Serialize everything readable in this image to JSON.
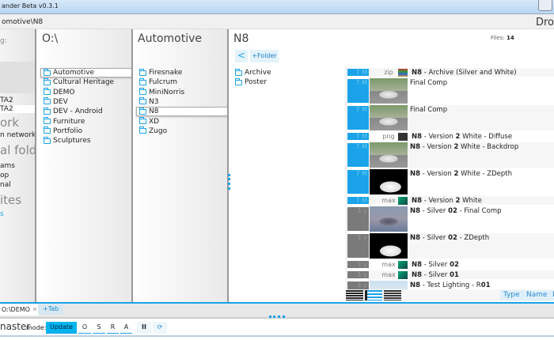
{
  "window": {
    "title": "ander Beta v0.3.1",
    "path": "omotive\\N8",
    "right_label": "Dro"
  },
  "sidebar": {
    "label": "g:",
    "items": [
      {
        "text": "TA2",
        "big": false,
        "sel": false
      },
      {
        "text": "TA2",
        "big": false,
        "sel": true
      },
      {
        "text": "ork",
        "big": true
      },
      {
        "text": "n network",
        "big": false
      },
      {
        "text": "al folder",
        "big": true
      },
      {
        "text": "ams",
        "big": false
      },
      {
        "text": "op",
        "big": false
      },
      {
        "text": "nal",
        "big": false
      },
      {
        "text": "ites",
        "big": true
      },
      {
        "text": "s",
        "big": false,
        "blue": true
      }
    ]
  },
  "columns": [
    {
      "header": "O:\\",
      "items": [
        "Automotive",
        "Cultural Heritage",
        "DEMO",
        "DEV",
        "DEV - Android",
        "Furniture",
        "Portfolio",
        "Sculptures"
      ],
      "selected": 0
    },
    {
      "header": "Automotive",
      "items": [
        "Firesnake",
        "Fulcrum",
        "MiniNorris",
        "N3",
        "N8",
        "XD",
        "Zugo"
      ],
      "selected": 4
    }
  ],
  "current": {
    "header": "N8",
    "back_label": "<",
    "add_folder_label": "+Folder",
    "items": [
      "Archive",
      "Poster"
    ]
  },
  "files_label": "Files:",
  "files_count": "14",
  "files": [
    {
      "age": "7 M",
      "recent": true,
      "type": "zip",
      "icon": "archive-icon",
      "name": [
        [
          "N8",
          1
        ],
        [
          " - Archive (Silver and White)",
          0
        ]
      ],
      "tall": false
    },
    {
      "age": "7 M",
      "recent": true,
      "thumb": "car-white",
      "name": [
        [
          "Final Comp",
          0
        ]
      ],
      "tall": true
    },
    {
      "age": "7 M",
      "recent": true,
      "thumb": "car-white",
      "name": [
        [
          "Final Comp",
          0
        ]
      ],
      "tall": true
    },
    {
      "age": "7 M",
      "recent": true,
      "type": "png",
      "icon": "image-icon",
      "name": [
        [
          "N8",
          1
        ],
        [
          " - Version ",
          0
        ],
        [
          "2",
          1
        ],
        [
          " White - Diffuse",
          0
        ]
      ],
      "tall": false
    },
    {
      "age": "7 M",
      "recent": true,
      "thumb": "car-white",
      "name": [
        [
          "N8",
          1
        ],
        [
          " - Version ",
          0
        ],
        [
          "2",
          1
        ],
        [
          " White - Backdrop",
          0
        ]
      ],
      "tall": true
    },
    {
      "age": "7 M",
      "recent": true,
      "thumb": "zdepth",
      "name": [
        [
          "N8",
          1
        ],
        [
          " - Version ",
          0
        ],
        [
          "2",
          1
        ],
        [
          " White - ZDepth",
          0
        ]
      ],
      "tall": true
    },
    {
      "age": "7 M",
      "recent": true,
      "type": "max",
      "icon": "max-icon",
      "name": [
        [
          "N8",
          1
        ],
        [
          " - Version ",
          0
        ],
        [
          "2",
          1
        ],
        [
          " White",
          0
        ]
      ],
      "tall": false
    },
    {
      "age": "1 y",
      "recent": false,
      "thumb": "car-silver",
      "name": [
        [
          "N8",
          1
        ],
        [
          " - Silver ",
          0
        ],
        [
          "02",
          1
        ],
        [
          " - Final Comp",
          0
        ]
      ],
      "tall": true
    },
    {
      "age": "1 y",
      "recent": false,
      "thumb": "zdepth",
      "name": [
        [
          "N8",
          1
        ],
        [
          " - Silver ",
          0
        ],
        [
          "02",
          1
        ],
        [
          " - ZDepth",
          0
        ]
      ],
      "tall": true
    },
    {
      "age": "1 y",
      "recent": false,
      "type": "max",
      "icon": "max-icon",
      "name": [
        [
          "N8",
          1
        ],
        [
          " - Silver ",
          0
        ],
        [
          "02",
          1
        ]
      ],
      "tall": false
    },
    {
      "age": "1 y",
      "recent": false,
      "type": "max",
      "icon": "max-icon",
      "name": [
        [
          "N8",
          1
        ],
        [
          " - Silver ",
          0
        ],
        [
          "01",
          1
        ]
      ],
      "tall": false
    },
    {
      "age": "1 y",
      "recent": false,
      "thumb": "light",
      "name": [
        [
          "N8",
          1
        ],
        [
          " - Test Lighting - R",
          0
        ],
        [
          "01",
          1
        ]
      ],
      "tall": true
    }
  ],
  "sort": [
    "Type",
    "Name",
    "D"
  ],
  "tabs": {
    "current": "O:\\DEMO",
    "add_label": "+Tab"
  },
  "status": {
    "branch": "naster",
    "mode_label": "mode:",
    "mode_active": "Update",
    "modes": [
      "O",
      "S",
      "R",
      "A"
    ],
    "pause": "II",
    "refresh": "⟳"
  },
  "colors": {
    "accent": "#1aa3e8",
    "old": "#7a7a7a"
  }
}
